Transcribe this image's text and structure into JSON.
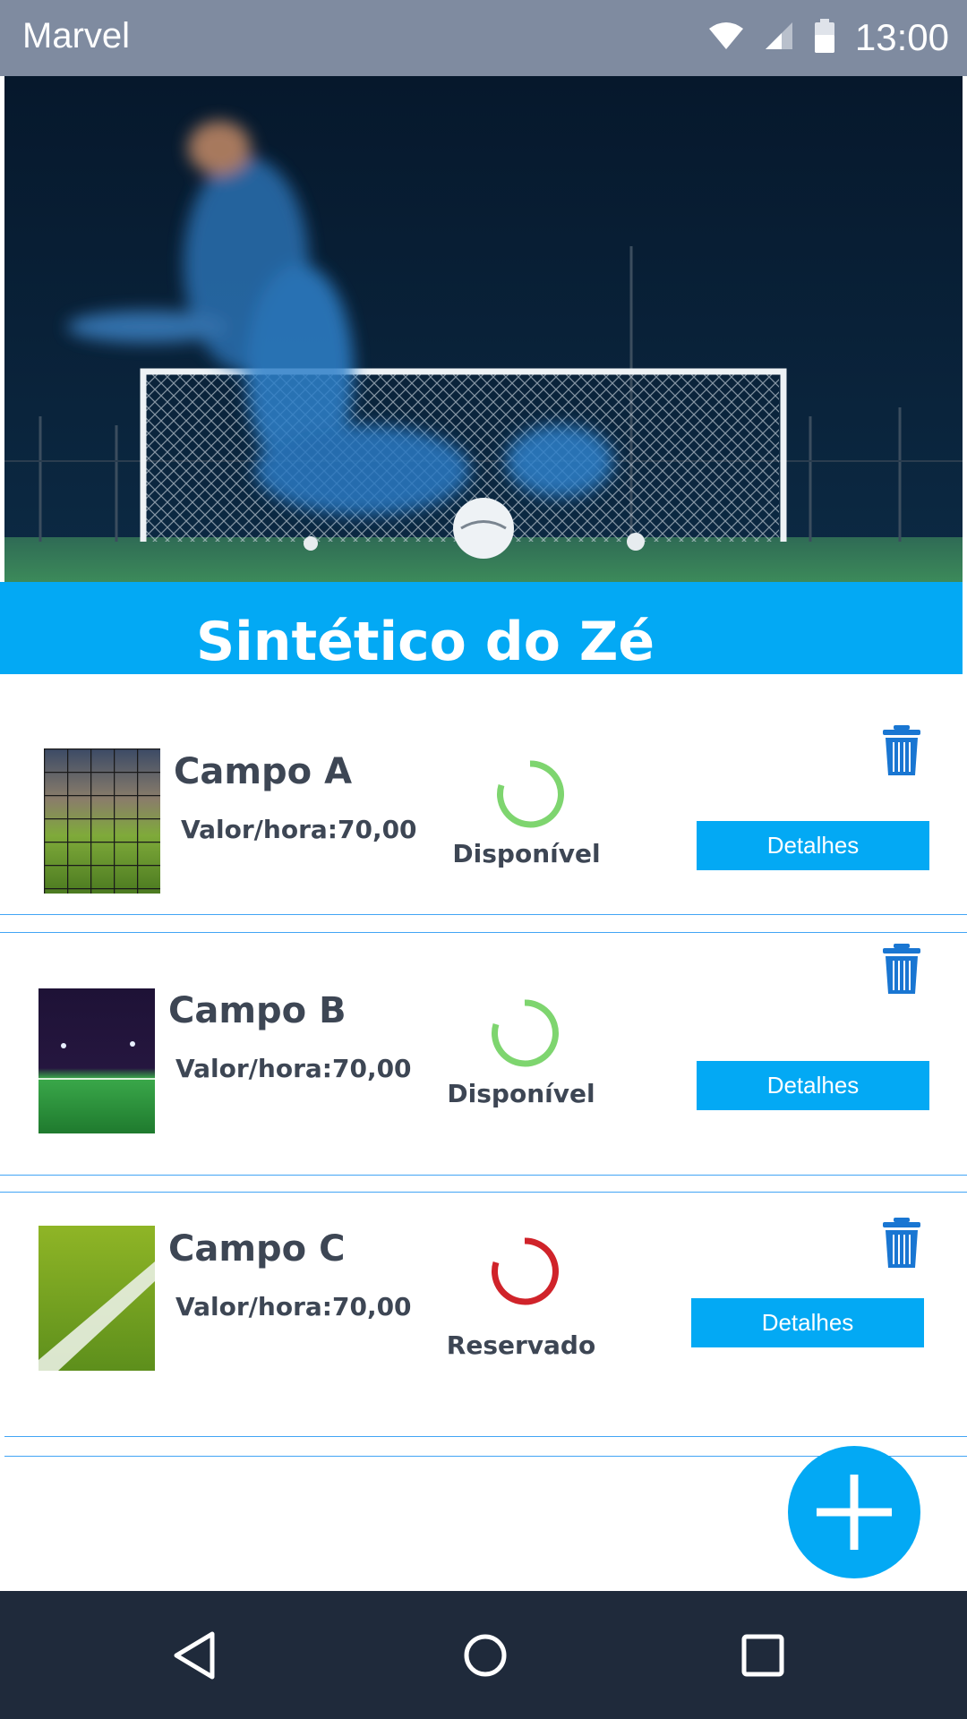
{
  "status_bar": {
    "app_name": "Marvel",
    "time": "13:00",
    "icons": [
      "wifi-icon",
      "signal-icon",
      "battery-icon"
    ]
  },
  "header": {
    "title": "Sintético do Zé"
  },
  "fields": [
    {
      "name": "Campo A",
      "price": "Valor/hora:70,00",
      "status": "Disponível",
      "status_color": "#7ed56f",
      "button_label": "Detalhes"
    },
    {
      "name": "Campo B",
      "price": "Valor/hora:70,00",
      "status": "Disponível",
      "status_color": "#7ed56f",
      "button_label": "Detalhes"
    },
    {
      "name": "Campo C",
      "price": "Valor/hora:70,00",
      "status": "Reservado",
      "status_color": "#d0232a",
      "button_label": "Detalhes"
    }
  ],
  "fab": {
    "icon": "plus-icon"
  },
  "navbar": {
    "icons": [
      "back-icon",
      "home-icon",
      "recents-icon"
    ]
  },
  "colors": {
    "accent": "#03a9f4",
    "status_bar": "#7f8ba0",
    "navbar": "#1f2a3b",
    "text": "#3d4654",
    "trash": "#1976d2"
  }
}
